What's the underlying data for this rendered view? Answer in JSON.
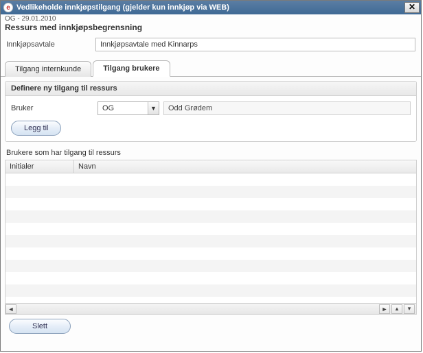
{
  "window": {
    "title": "Vedlikeholde innkjøpstilgang (gjelder kun innkjøp via WEB)",
    "app_icon_letter": "e"
  },
  "meta": "OG - 29.01.2010",
  "section_heading": "Ressurs med innkjøpsbegrensning",
  "agreement": {
    "label": "Innkjøpsavtale",
    "value": "Innkjøpsavtale med Kinnarps"
  },
  "tabs": {
    "internal": "Tilgang internkunde",
    "users": "Tilgang brukere"
  },
  "define": {
    "group_title": "Definere ny tilgang til ressurs",
    "bruker_label": "Bruker",
    "bruker_code": "OG",
    "bruker_name": "Odd Grødem",
    "add_label": "Legg til"
  },
  "list": {
    "heading": "Brukere som har tilgang til ressurs",
    "col_initials": "Initialer",
    "col_name": "Navn"
  },
  "footer": {
    "delete_label": "Slett"
  }
}
